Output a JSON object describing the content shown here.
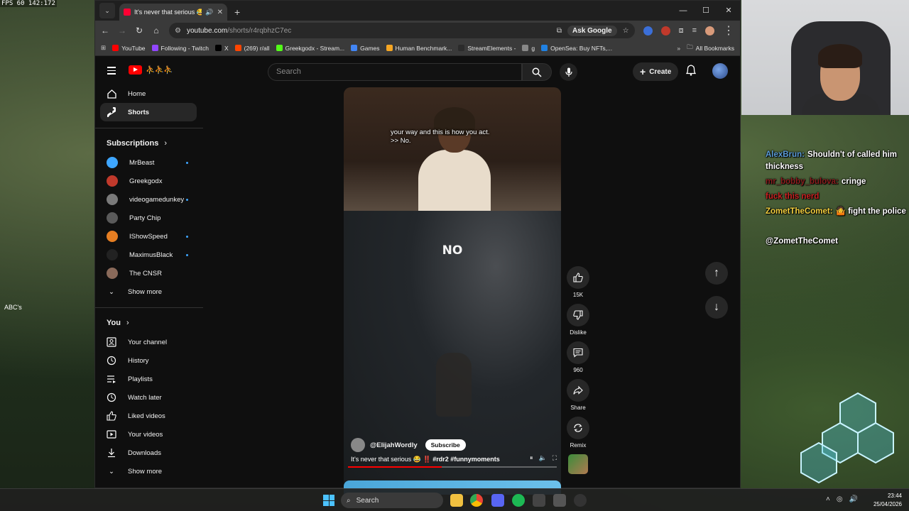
{
  "overlay": {
    "fps": "FPS 60  142:172",
    "side_label": "ABC's"
  },
  "browser": {
    "tab_title": "It's never that serious 😂‼️ #",
    "url_host": "youtube.com",
    "url_path": "/shorts/r4rqbhzC7ec",
    "ask_google": "Ask Google",
    "bookmarks": [
      {
        "label": "YouTube",
        "color": "#ff0000"
      },
      {
        "label": "Following - Twitch",
        "color": "#9146ff"
      },
      {
        "label": "X",
        "color": "#000000"
      },
      {
        "label": "(269) r/all",
        "color": "#ff4500"
      },
      {
        "label": "Greekgodx - Stream...",
        "color": "#53fc18"
      },
      {
        "label": "Games",
        "color": "#4285f4"
      },
      {
        "label": "Human Benchmark...",
        "color": "#f5a623"
      },
      {
        "label": "StreamElements -",
        "color": "#2b2b2b"
      },
      {
        "label": "g",
        "color": "#888888"
      },
      {
        "label": "OpenSea: Buy NFTs,...",
        "color": "#2081e2"
      }
    ],
    "all_bookmarks": "All Bookmarks"
  },
  "youtube": {
    "search_placeholder": "Search",
    "create_label": "Create",
    "sidebar": {
      "home": "Home",
      "shorts": "Shorts",
      "subscriptions_heading": "Subscriptions",
      "channels": [
        {
          "name": "MrBeast",
          "new": true,
          "color": "#3ea6ff"
        },
        {
          "name": "Greekgodx",
          "new": false,
          "color": "#c0392b"
        },
        {
          "name": "videogamedunkey",
          "new": true,
          "color": "#7a7a7a"
        },
        {
          "name": "Party Chip",
          "new": false,
          "color": "#5a5a5a"
        },
        {
          "name": "IShowSpeed",
          "new": true,
          "color": "#e67e22"
        },
        {
          "name": "MaximusBlack",
          "new": true,
          "color": "#222222"
        },
        {
          "name": "The CNSR",
          "new": false,
          "color": "#8a6a5a"
        }
      ],
      "show_more": "Show more",
      "you_heading": "You",
      "you_items": [
        {
          "label": "Your channel",
          "icon": "person-icon"
        },
        {
          "label": "History",
          "icon": "history-icon"
        },
        {
          "label": "Playlists",
          "icon": "playlists-icon"
        },
        {
          "label": "Watch later",
          "icon": "clock-icon"
        },
        {
          "label": "Liked videos",
          "icon": "thumb-up-icon"
        },
        {
          "label": "Your videos",
          "icon": "video-icon"
        },
        {
          "label": "Downloads",
          "icon": "download-icon"
        }
      ],
      "show_more_2": "Show more"
    },
    "short": {
      "caption_line1": "your way and this is how you act.",
      "caption_line2": ">> No.",
      "big_word": "NO",
      "channel": "@ElijahWordly",
      "subscribe": "Subscribe",
      "title_text": "It's never that serious 😂 ‼️",
      "title_tags": "#rdr2 #funnymoments",
      "progress": 0.45
    },
    "actions": {
      "likes": "15K",
      "dislike": "Dislike",
      "comments": "960",
      "share": "Share",
      "remix": "Remix"
    }
  },
  "chat": [
    {
      "user": "AlexBrun:",
      "text": "Shouldn't of called him thickness",
      "color": "#5b9bd5"
    },
    {
      "user": "mr_bobby_bulova:",
      "text": "cringe",
      "color": "#8b1e1e"
    },
    {
      "user": "",
      "text": "fuck this nerd",
      "color": "#cc2222"
    },
    {
      "user": "ZometTheComet:",
      "text": "🤷 fight the police",
      "color": "#f4d03f"
    },
    {
      "user": "",
      "text": "",
      "color": "#8b1e1e"
    },
    {
      "user": "",
      "text": "@ZometTheComet",
      "color": "#ffffff"
    }
  ],
  "taskbar": {
    "search": "Search",
    "time": "23:44",
    "date": "25/04/2026"
  }
}
